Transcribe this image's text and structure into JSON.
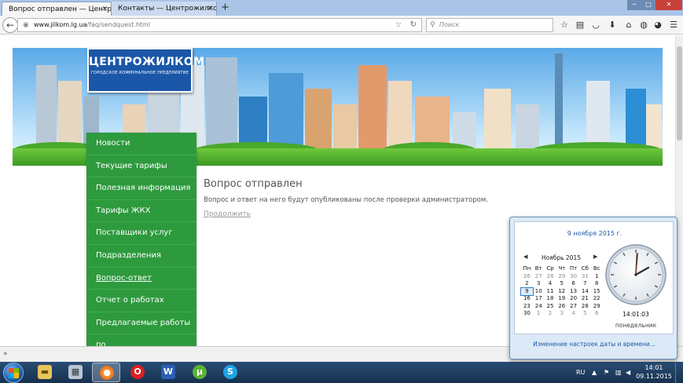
{
  "browser": {
    "tabs": [
      {
        "label": "Вопрос отправлен — Центро...",
        "active": true
      },
      {
        "label": "Контакты — Центрожилком",
        "active": false
      }
    ],
    "new_tab": "+",
    "url_host": "www.jilkom.lg.ua",
    "url_path": "/faq/sendquest.html",
    "search_placeholder": "Поиск"
  },
  "site": {
    "logo_name": "ЦЕНТРОЖИЛКОМ",
    "logo_sub": "ГОРОДСКОЕ КОММУНАЛЬНОЕ ПРЕДПРИЯТИЕ",
    "nav": [
      {
        "label": "Новости"
      },
      {
        "label": "Текущие тарифы"
      },
      {
        "label": "Полезная информация"
      },
      {
        "label": "Тарифы ЖКХ"
      },
      {
        "label": "Поставщики услуг"
      },
      {
        "label": "Подразделения"
      },
      {
        "label": "Вопрос-ответ"
      },
      {
        "label": "Отчет о работах"
      },
      {
        "label": "Предлагаемые работы по"
      }
    ],
    "main_title": "Вопрос отправлен",
    "main_text": "Вопрос и ответ на него будут опубликованы после проверки администратором.",
    "continue_link": "Продолжить"
  },
  "addon_bar": "»",
  "clock_popup": {
    "date_link": "9 ноября 2015 г.",
    "month": "Ноябрь 2015",
    "weekdays": [
      "Пн",
      "Вт",
      "Ср",
      "Чт",
      "Пт",
      "Сб",
      "Вс"
    ],
    "weeks": [
      [
        "26",
        "27",
        "28",
        "29",
        "30",
        "31",
        "1"
      ],
      [
        "2",
        "3",
        "4",
        "5",
        "6",
        "7",
        "8"
      ],
      [
        "9",
        "10",
        "11",
        "12",
        "13",
        "14",
        "15"
      ],
      [
        "16",
        "17",
        "18",
        "19",
        "20",
        "21",
        "22"
      ],
      [
        "23",
        "24",
        "25",
        "26",
        "27",
        "28",
        "29"
      ],
      [
        "30",
        "1",
        "2",
        "3",
        "4",
        "5",
        "6"
      ]
    ],
    "time": "14:01:03",
    "weekday": "понедельник",
    "settings_link": "Изменение настроек даты и времени..."
  },
  "taskbar": {
    "language": "RU",
    "time": "14:01",
    "date": "09.11.2015"
  }
}
